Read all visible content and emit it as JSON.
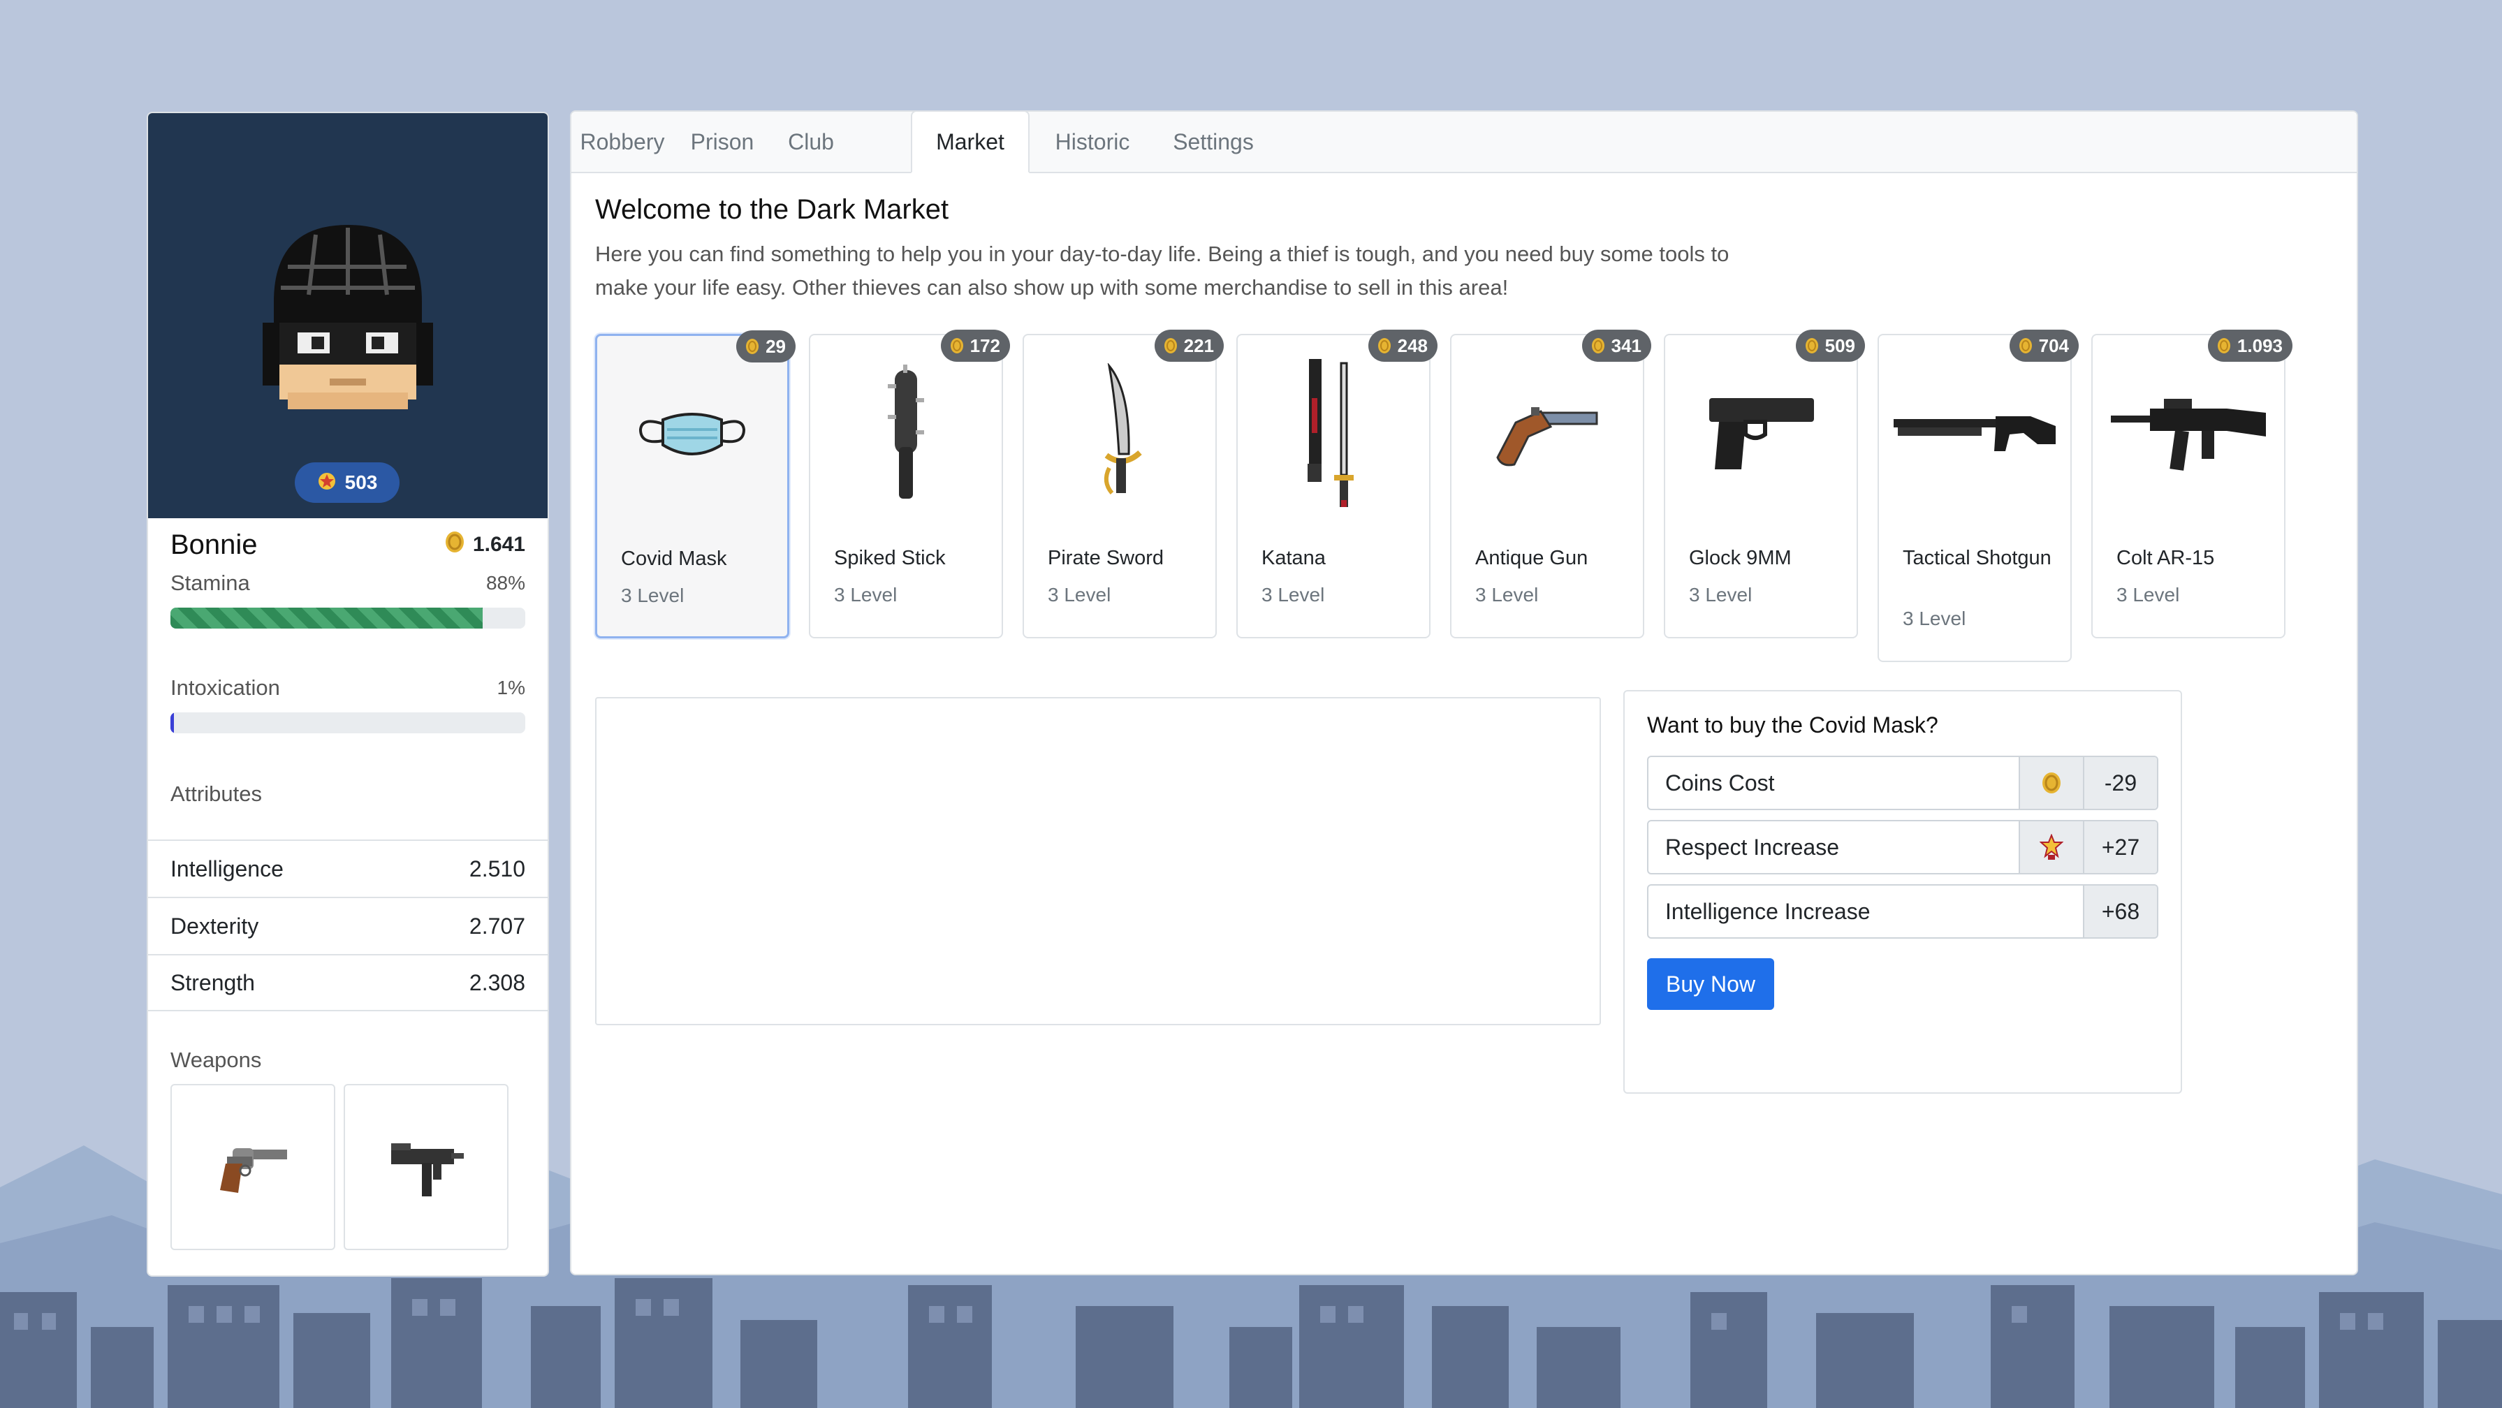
{
  "player": {
    "name": "Bonnie",
    "respect": "503",
    "coins": "1.641",
    "stamina_label": "Stamina",
    "stamina_pct": "88%",
    "stamina_value": 0.88,
    "intox_label": "Intoxication",
    "intox_pct": "1%",
    "intox_value": 0.01,
    "attributes_title": "Attributes",
    "attributes": [
      {
        "label": "Intelligence",
        "value": "2.510"
      },
      {
        "label": "Dexterity",
        "value": "2.707"
      },
      {
        "label": "Strength",
        "value": "2.308"
      }
    ],
    "weapons_title": "Weapons",
    "weapons": [
      "revolver-icon",
      "uzi-icon"
    ]
  },
  "tabs": [
    "Robbery",
    "Prison",
    "Club",
    "Market",
    "Historic",
    "Settings"
  ],
  "active_tab": "Market",
  "market": {
    "title": "Welcome to the Dark Market",
    "description": "Here you can find something to help you in your day-to-day life. Being a thief is tough, and you need buy some tools to make your life easy. Other thieves can also show up with some merchandise to sell in this area!",
    "items": [
      {
        "name": "Covid Mask",
        "level": "3 Level",
        "price": "29",
        "icon": "covid-mask-icon"
      },
      {
        "name": "Spiked Stick",
        "level": "3 Level",
        "price": "172",
        "icon": "spiked-stick-icon"
      },
      {
        "name": "Pirate Sword",
        "level": "3 Level",
        "price": "221",
        "icon": "pirate-sword-icon"
      },
      {
        "name": "Katana",
        "level": "3 Level",
        "price": "248",
        "icon": "katana-icon"
      },
      {
        "name": "Antique Gun",
        "level": "3 Level",
        "price": "341",
        "icon": "antique-gun-icon"
      },
      {
        "name": "Glock 9MM",
        "level": "3 Level",
        "price": "509",
        "icon": "glock-icon"
      },
      {
        "name": "Tactical Shotgun",
        "level": "3 Level",
        "price": "704",
        "icon": "shotgun-icon"
      },
      {
        "name": "Colt AR-15",
        "level": "3 Level",
        "price": "1.093",
        "icon": "rifle-icon"
      }
    ],
    "selected_item": "Covid Mask"
  },
  "buy": {
    "title": "Want to buy the Covid Mask?",
    "rows": [
      {
        "label": "Coins Cost",
        "value": "-29",
        "icon": "coin-icon"
      },
      {
        "label": "Respect Increase",
        "value": "+27",
        "icon": "star-badge-icon"
      },
      {
        "label": "Intelligence Increase",
        "value": "+68"
      }
    ],
    "button": "Buy Now"
  },
  "colors": {
    "background": "#bac6dc",
    "avatar_panel": "#213650",
    "primary": "#1f6fea",
    "stamina": "#2f8b57",
    "intoxication": "#3a3fd6"
  }
}
